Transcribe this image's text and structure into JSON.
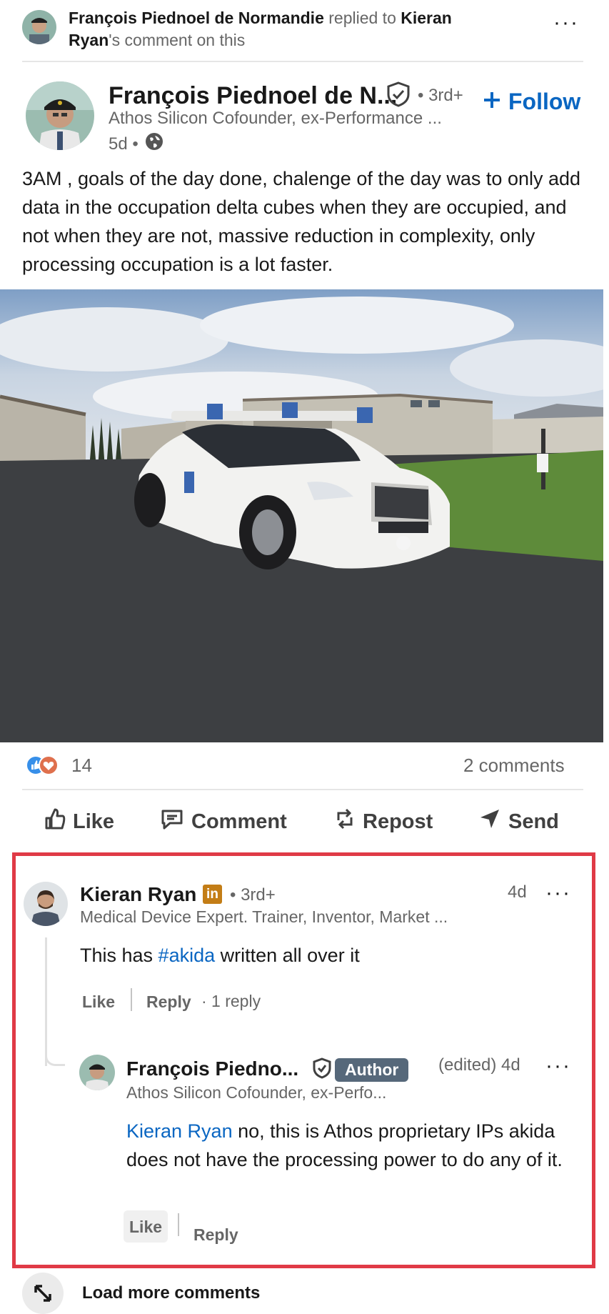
{
  "notice": {
    "actor": "François Piednoel de Normandie",
    "verb": " replied to ",
    "target": "Kieran Ryan",
    "suffix": "'s comment on this"
  },
  "post": {
    "author_name": "François Piednoel de N...",
    "degree": "• 3rd+",
    "headline": "Athos Silicon Cofounder, ex-Performance ...",
    "time": "5d •",
    "follow_label": "Follow",
    "body": "3AM , goals of the day done, chalenge of the day was to only add data in the occupation delta cubes when they are occupied, and not when they are not, massive reduction in complexity, only processing occupation is a lot faster.",
    "reaction_count": "14",
    "comments_count": "2 comments"
  },
  "actions": {
    "like": "Like",
    "comment": "Comment",
    "repost": "Repost",
    "send": "Send"
  },
  "comment1": {
    "name": "Kieran Ryan",
    "badge": "in",
    "degree": "• 3rd+",
    "time": "4d",
    "headline": "Medical Device Expert. Trainer, Inventor, Market ...",
    "text_before": "This has ",
    "hashtag": "#akida",
    "text_after": " written all over it",
    "like": "Like",
    "reply": "Reply",
    "replies": "· 1 reply"
  },
  "reply1": {
    "name": "François Piedno...",
    "author_badge": "Author",
    "time": "(edited) 4d",
    "headline": "Athos Silicon Cofounder, ex-Perfo...",
    "mention": "Kieran Ryan",
    "text": " no, this is Athos proprietary IPs akida does not have the processing power to do any of it.",
    "like": "Like",
    "reply": "Reply"
  },
  "load_more": "Load more comments",
  "colors": {
    "link": "#0a66c2",
    "highlight": "#e03a46",
    "author_badge": "#56687a",
    "in_badge": "#c37d16"
  }
}
